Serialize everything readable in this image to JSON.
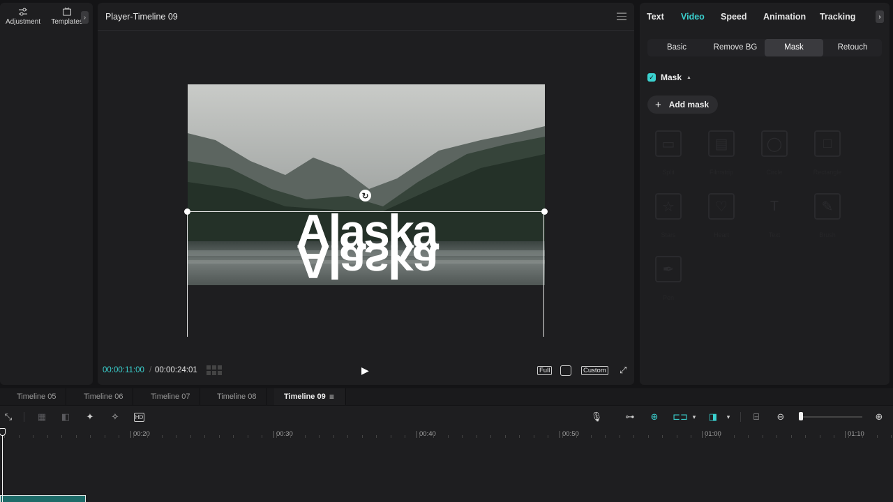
{
  "left_panel": {
    "tools": [
      {
        "label": "Adjustment",
        "icon": "sliders-icon"
      },
      {
        "label": "Templates",
        "icon": "template-icon"
      }
    ],
    "arrow": "›"
  },
  "player": {
    "title": "Player-Timeline 09",
    "overlay_text": "Alaska",
    "current_time": "00:00:11:00",
    "separator": "/",
    "total_time": "00:00:24:01",
    "buttons": {
      "full": "Full",
      "custom": "Custom"
    }
  },
  "right_panel": {
    "tabs": [
      "Text",
      "Video",
      "Speed",
      "Animation",
      "Tracking"
    ],
    "active_tab": "Video",
    "subtabs": [
      "Basic",
      "Remove BG",
      "Mask",
      "Retouch"
    ],
    "active_subtab": "Mask",
    "mask_label": "Mask",
    "mask_checked": true,
    "add_mask_label": "Add mask",
    "mask_shapes": [
      {
        "label": "Split",
        "icon": "split-icon"
      },
      {
        "label": "Filmstrip",
        "icon": "filmstrip-icon"
      },
      {
        "label": "Circle",
        "icon": "circle-icon"
      },
      {
        "label": "Rectangle",
        "icon": "rectangle-icon"
      },
      {
        "label": "Stars",
        "icon": "star-icon"
      },
      {
        "label": "Heart",
        "icon": "heart-icon"
      },
      {
        "label": "Text",
        "icon": "text-icon"
      },
      {
        "label": "Brush",
        "icon": "brush-icon"
      },
      {
        "label": "Pen",
        "icon": "pen-icon"
      }
    ]
  },
  "timeline": {
    "tabs": [
      "Timeline 05",
      "Timeline 06",
      "Timeline 07",
      "Timeline 08",
      "Timeline 09"
    ],
    "active_tab": "Timeline 09",
    "ruler_labels": [
      "00:20",
      "00:30",
      "00:40",
      "00:50",
      "01:00",
      "01:10"
    ],
    "zoom_level": 0.05
  },
  "colors": {
    "accent": "#3ad1cf",
    "background": "#141416",
    "panel": "#1e1e20"
  }
}
